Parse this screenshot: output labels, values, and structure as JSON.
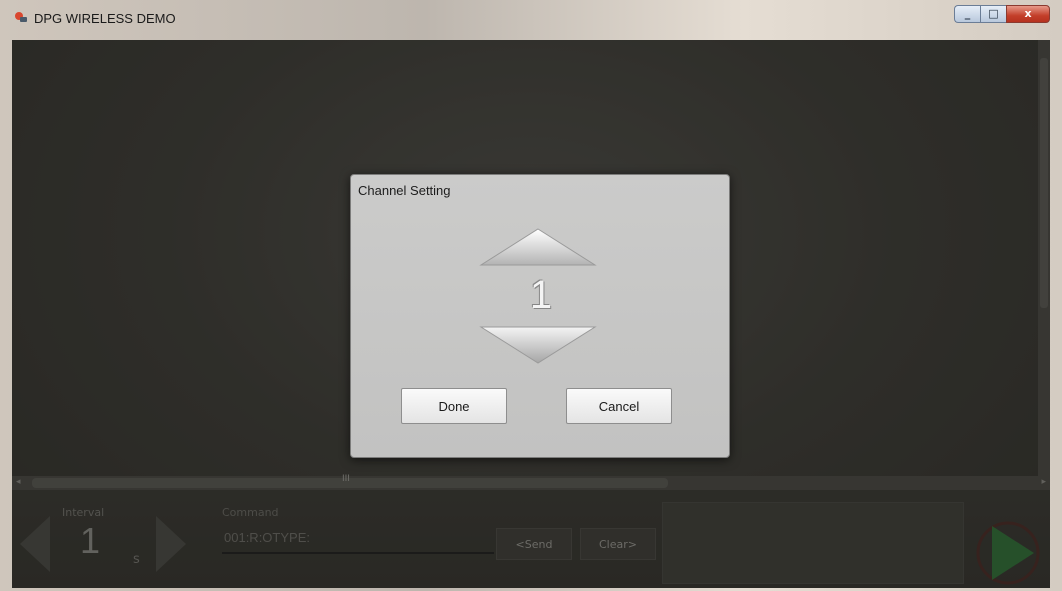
{
  "window": {
    "title": "DPG WIRELESS DEMO",
    "controls": {
      "minimize": "minimize-icon",
      "maximize": "maximize-icon",
      "close": "close-icon"
    }
  },
  "dialog": {
    "title": "Channel Setting",
    "channel_value": "1",
    "done_label": "Done",
    "cancel_label": "Cancel",
    "icons": {
      "up": "triangle-up-icon",
      "down": "triangle-down-icon"
    }
  },
  "bottom_bar": {
    "interval_label": "Interval",
    "interval_value": "1",
    "interval_unit": "s",
    "command_label": "Command",
    "command_value": "001:R:OTYPE:",
    "send_label": "<Send",
    "clear_label": "Clear>",
    "icons": {
      "decrease": "chevron-left-icon",
      "increase": "chevron-right-icon",
      "play": "play-icon"
    }
  },
  "scrollbar": {
    "grip": "III"
  },
  "colors": {
    "accent_play": "#2f7a3a",
    "dialog_bg": "#c6c6c5",
    "client_bg": "#3d3c37"
  }
}
